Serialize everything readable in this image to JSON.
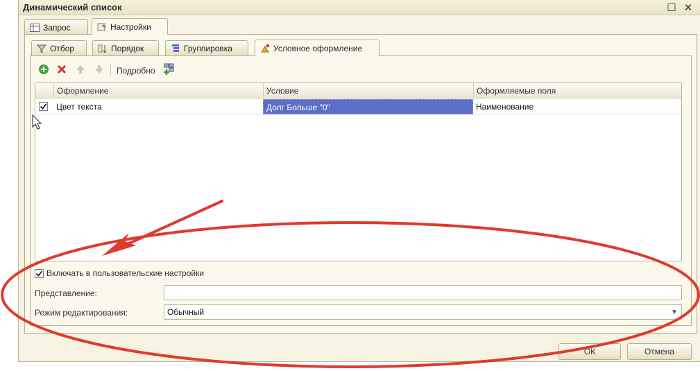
{
  "window": {
    "title": "Динамический список",
    "maximize_glyph": "☐",
    "close_glyph": "✕"
  },
  "outer_tabs": [
    {
      "label": "Запрос",
      "icon": "table-icon"
    },
    {
      "label": "Настройки",
      "icon": "wrench-icon",
      "active": true
    }
  ],
  "inner_tabs": [
    {
      "label": "Отбор",
      "icon": "filter-icon"
    },
    {
      "label": "Порядок",
      "icon": "sort-icon"
    },
    {
      "label": "Группировка",
      "icon": "grouping-icon"
    },
    {
      "label": "Условное оформление",
      "icon": "paint-icon",
      "active": true
    }
  ],
  "toolbar": {
    "details_label": "Подробно",
    "add_color": "#3aa53a",
    "delete_color": "#d23a2a"
  },
  "grid": {
    "columns": [
      "Оформление",
      "Условие",
      "Оформляемые поля"
    ],
    "rows": [
      {
        "checked": true,
        "appearance": "Цвет текста",
        "condition": "Долг Больше \"0\"",
        "fields": "Наименование"
      }
    ]
  },
  "form": {
    "include_label": "Включать в пользовательские настройки",
    "include_checked": true,
    "presentation_label": "Представление:",
    "presentation_value": "",
    "edit_mode_label": "Режим редактирования:",
    "edit_mode_value": "Обычный"
  },
  "buttons": {
    "ok": "ОК",
    "cancel": "Отмена"
  },
  "annotation_color": "#e03a2e",
  "selection_color": "#5b6fc9"
}
